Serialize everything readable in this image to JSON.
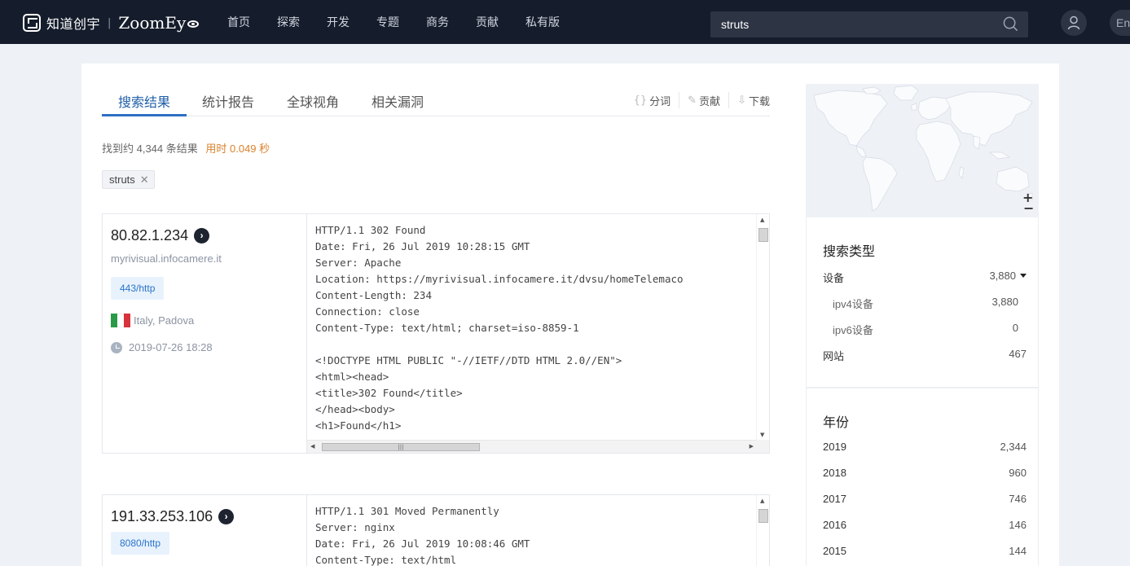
{
  "brand": {
    "cn": "知道创宇",
    "sep": "|",
    "en": "ZoomEy"
  },
  "nav": [
    "首页",
    "探索",
    "开发",
    "专题",
    "商务",
    "贡献",
    "私有版"
  ],
  "search": {
    "value": "struts"
  },
  "lang": "En",
  "tabs": [
    "搜索结果",
    "统计报告",
    "全球视角",
    "相关漏洞"
  ],
  "tools": [
    {
      "icon": "{}",
      "label": "分词"
    },
    {
      "icon": "✎",
      "label": "贡献"
    },
    {
      "icon": "⇩",
      "label": "下载"
    }
  ],
  "summary": {
    "found": "找到约 4,344 条结果",
    "time": "用时 0.049 秒"
  },
  "filter_chip": "struts",
  "results": [
    {
      "ip": "80.82.1.234",
      "host": "myrivisual.infocamere.it",
      "port": "443/http",
      "location": "Italy, Padova",
      "date": "2019-07-26 18:28",
      "banner": "HTTP/1.1 302 Found\nDate: Fri, 26 Jul 2019 10:28:15 GMT\nServer: Apache\nLocation: https://myrivisual.infocamere.it/dvsu/homeTelemaco\nContent-Length: 234\nConnection: close\nContent-Type: text/html; charset=iso-8859-1\n\n<!DOCTYPE HTML PUBLIC \"-//IETF//DTD HTML 2.0//EN\">\n<html><head>\n<title>302 Found</title>\n</head><body>\n<h1>Found</h1>"
    },
    {
      "ip": "191.33.253.106",
      "port": "8080/http",
      "banner": "HTTP/1.1 301 Moved Permanently\nServer: nginx\nDate: Fri, 26 Jul 2019 10:08:46 GMT\nContent-Type: text/html"
    }
  ],
  "sidebar": {
    "search_type": {
      "title": "搜索类型",
      "rows": [
        {
          "label": "设备",
          "value": "3,880"
        },
        {
          "label": "ipv4设备",
          "value": "3,880"
        },
        {
          "label": "ipv6设备",
          "value": "0"
        },
        {
          "label": "网站",
          "value": "467"
        }
      ]
    },
    "year": {
      "title": "年份",
      "rows": [
        {
          "label": "2019",
          "value": "2,344"
        },
        {
          "label": "2018",
          "value": "960"
        },
        {
          "label": "2017",
          "value": "746"
        },
        {
          "label": "2016",
          "value": "146"
        },
        {
          "label": "2015",
          "value": "144"
        }
      ]
    },
    "map_zoom": {
      "in": "+",
      "out": "−"
    }
  },
  "colors": {
    "topbar": "#151c2b",
    "accent": "#2e6fc4",
    "time": "#d9822b",
    "port_bg": "#e8f2fd"
  }
}
